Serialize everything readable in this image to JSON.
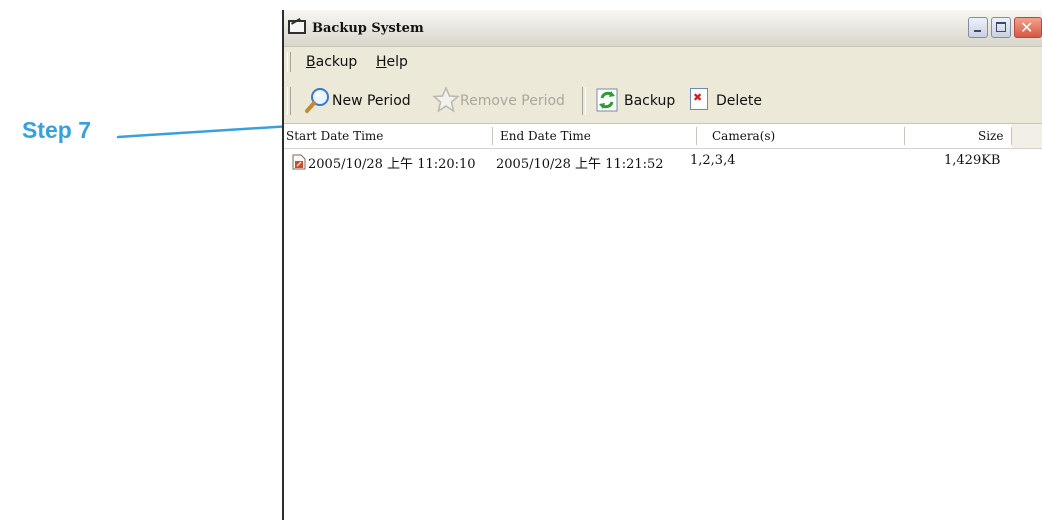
{
  "annotation": {
    "step_label": "Step 7"
  },
  "window": {
    "title": "Backup System",
    "title_icon": "app-window-icon",
    "controls": {
      "minimize_icon": "minimize-icon",
      "maximize_icon": "maximize-icon",
      "close_icon": "close-icon"
    }
  },
  "menu": {
    "backup": {
      "mnemonic": "B",
      "rest": "ackup"
    },
    "help": {
      "mnemonic": "H",
      "rest": "elp"
    }
  },
  "toolbar": {
    "new_period": {
      "label": "New Period",
      "icon": "magnifier-icon",
      "enabled": true
    },
    "remove_period": {
      "label": "Remove Period",
      "icon": "star-icon",
      "enabled": false
    },
    "backup": {
      "label": "Backup",
      "icon": "refresh-icon",
      "enabled": true
    },
    "delete": {
      "label": "Delete",
      "icon": "delete-icon",
      "enabled": true
    }
  },
  "list": {
    "columns": [
      "Start Date Time",
      "End Date Time",
      "Camera(s)",
      "Size"
    ],
    "rows": [
      {
        "icon": "file-icon",
        "start": "2005/10/28 上午 11:20:10",
        "end": "2005/10/28 上午 11:21:52",
        "cameras": "1,2,3,4",
        "size": "1,429KB"
      }
    ]
  },
  "colors": {
    "annotation": "#3aa0dc",
    "chrome": "#ece9d8",
    "close_button": "#d35a40"
  }
}
